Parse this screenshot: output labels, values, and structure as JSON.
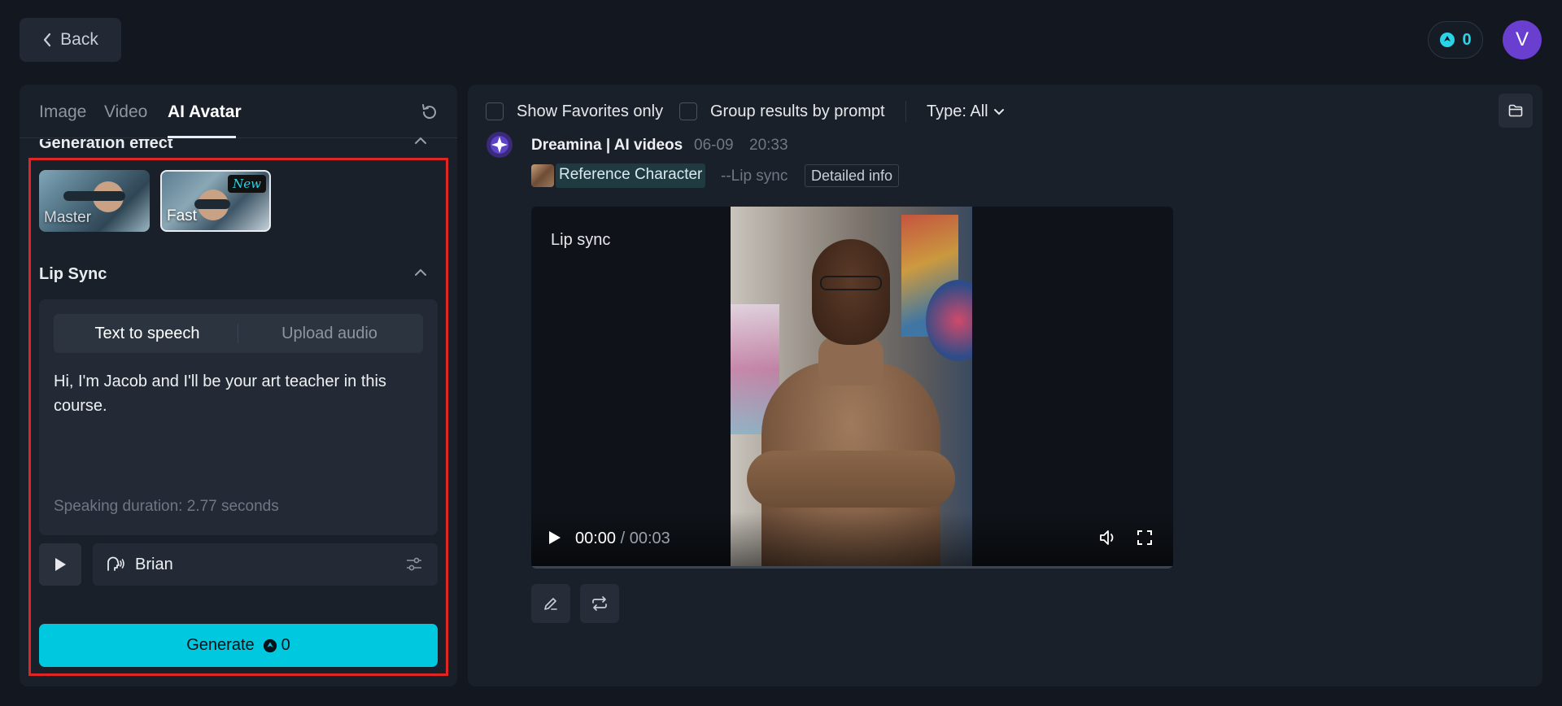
{
  "header": {
    "back_label": "Back",
    "credits": "0",
    "avatar_initial": "V"
  },
  "left_panel": {
    "tabs": [
      {
        "label": "Image",
        "active": false
      },
      {
        "label": "Video",
        "active": false
      },
      {
        "label": "AI Avatar",
        "active": true
      }
    ],
    "generation_effect": {
      "title": "Generation effect",
      "options": [
        {
          "label": "Master",
          "selected": false
        },
        {
          "label": "Fast",
          "selected": true,
          "badge": "New"
        }
      ]
    },
    "lip_sync": {
      "title": "Lip Sync",
      "modes": [
        {
          "label": "Text to speech",
          "active": true
        },
        {
          "label": "Upload audio",
          "active": false
        }
      ],
      "text": "Hi, I'm Jacob and I'll be your art teacher in this course.",
      "duration": "Speaking duration: 2.77 seconds",
      "voice": "Brian"
    },
    "generate": {
      "label": "Generate",
      "cost": "0"
    }
  },
  "right_panel": {
    "filters": {
      "favorites_label": "Show Favorites only",
      "group_label": "Group results by prompt",
      "type_label": "Type: All"
    },
    "result": {
      "author": "Dreamina | AI videos",
      "date": "06-09",
      "time": "20:33",
      "reference_label": "Reference Character",
      "mode_tag": "--Lip sync",
      "detail_label": "Detailed info",
      "video": {
        "overlay_label": "Lip sync",
        "current_time": "00:00",
        "total_time": "/ 00:03",
        "progress": 0
      }
    }
  },
  "colors": {
    "accent": "#00c8df",
    "background": "#121720",
    "panel": "#1a2029",
    "highlight_border": "#e02525",
    "avatar": "#6a3fd0"
  }
}
